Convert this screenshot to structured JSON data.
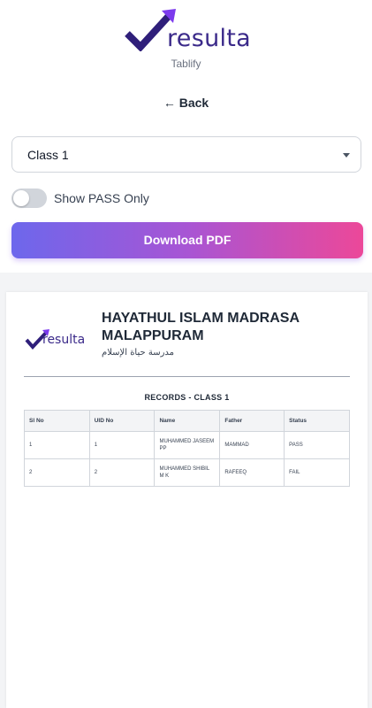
{
  "header": {
    "logo_text": "resulta",
    "tagline": "Tablify",
    "back_label": "← Back"
  },
  "controls": {
    "class_select": "Class 1",
    "toggle_label": "Show PASS Only",
    "toggle_on": false,
    "download_label": "Download PDF"
  },
  "colors": {
    "brand": "#3b2a8a",
    "accent": "#7c3aed",
    "gradient_start": "#6d67ec",
    "gradient_end": "#ec4899"
  },
  "document": {
    "logo_text": "resulta",
    "institution": "HAYATHUL ISLAM MADRASA MALAPPURAM",
    "arabic_name": "مدرسة حياة الإسلام",
    "records_title": "RECORDS - CLASS 1",
    "columns": [
      "Sl No",
      "UID No",
      "Name",
      "Father",
      "Status"
    ],
    "rows": [
      [
        "1",
        "1",
        "MUHAMMED JASEEM PP",
        "MAMMAD",
        "PASS"
      ],
      [
        "2",
        "2",
        "MUHAMMED SHIBIL M K",
        "RAFEEQ",
        "FAIL"
      ]
    ]
  }
}
